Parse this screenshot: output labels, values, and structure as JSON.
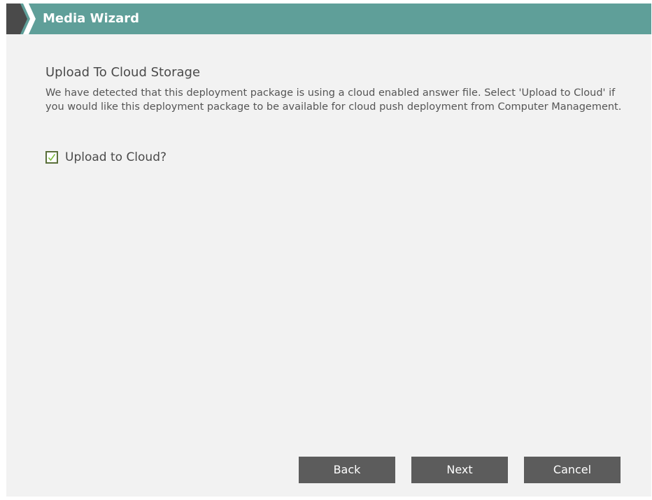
{
  "window": {
    "title": "Media Wizard"
  },
  "page": {
    "heading": "Upload To Cloud Storage",
    "description": "We have detected that this deployment package is using a cloud enabled answer file. Select 'Upload to Cloud' if you would like this deployment package to be available for cloud push deployment from Computer Management."
  },
  "upload_checkbox": {
    "label": "Upload to Cloud?",
    "checked": true
  },
  "buttons": {
    "back": "Back",
    "next": "Next",
    "cancel": "Cancel"
  },
  "colors": {
    "titlebar": "#5f9f99",
    "button": "#5c5c5c",
    "checkmark": "#7fbf3f"
  }
}
